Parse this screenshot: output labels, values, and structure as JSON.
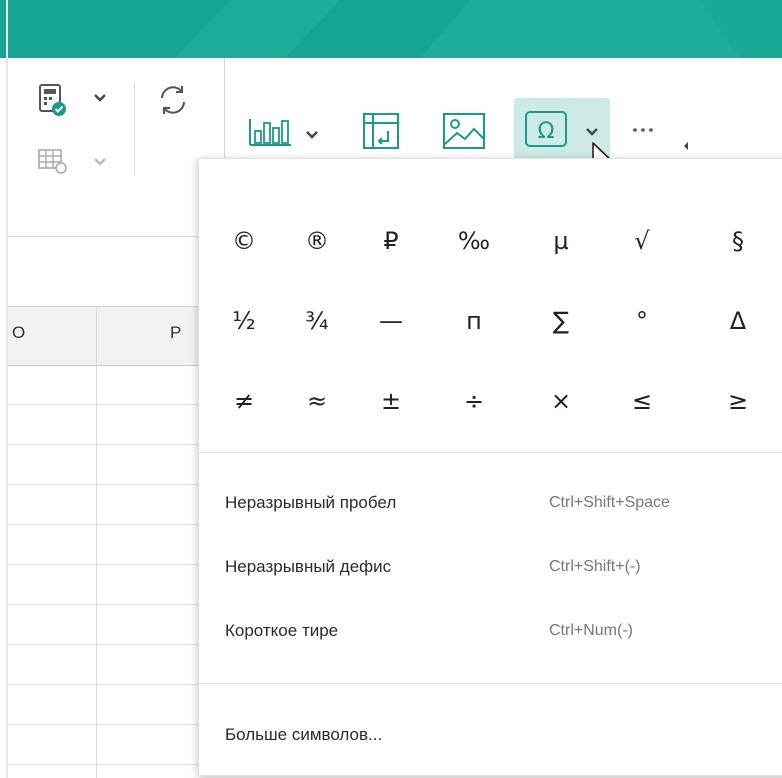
{
  "colors": {
    "titlebar": "#16a594",
    "accent_active": "#cdeae6",
    "icon_green": "#1a9b86"
  },
  "ribbon": {
    "icons": [
      "calculator-check-icon",
      "table-refresh-icon",
      "refresh-icon",
      "bar-chart-icon",
      "pivot-table-icon",
      "image-icon",
      "omega-symbol-icon",
      "more-options-icon"
    ]
  },
  "sheet": {
    "columns": [
      "O",
      "P"
    ]
  },
  "symbols_menu": {
    "symbols": [
      [
        "©",
        "®",
        "₽",
        "‰",
        "µ",
        "√",
        "§"
      ],
      [
        "½",
        "¾",
        "—",
        "п",
        "∑",
        "°",
        "Δ"
      ],
      [
        "≠",
        "≈",
        "±",
        "÷",
        "×",
        "≤",
        "≥"
      ]
    ],
    "items": [
      {
        "label": "Неразрывный пробел",
        "shortcut": "Ctrl+Shift+Space"
      },
      {
        "label": "Неразрывный дефис",
        "shortcut": "Ctrl+Shift+(-)"
      },
      {
        "label": "Короткое тире",
        "shortcut": "Ctrl+Num(-)"
      }
    ],
    "more_symbols": "Больше символов..."
  }
}
